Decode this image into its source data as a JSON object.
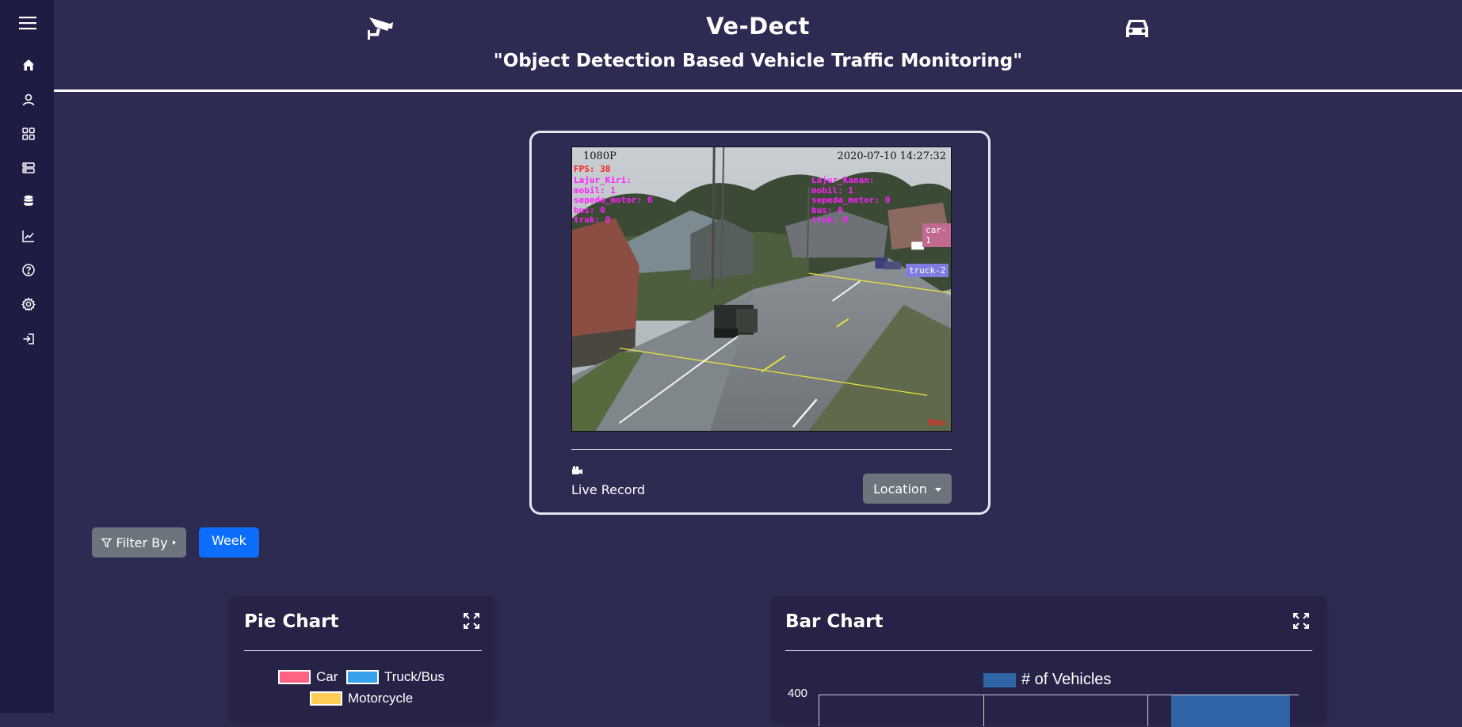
{
  "sidebar": {
    "menu_icon": "hamburger-icon",
    "items": [
      {
        "icon": "home-icon"
      },
      {
        "icon": "user-icon"
      },
      {
        "icon": "grid-icon"
      },
      {
        "icon": "server-icon"
      },
      {
        "icon": "database-icon"
      },
      {
        "icon": "chart-line-icon"
      },
      {
        "icon": "help-icon"
      },
      {
        "icon": "settings-icon"
      },
      {
        "icon": "logout-icon"
      }
    ]
  },
  "header": {
    "title": "Ve-Dect",
    "subtitle": "\"Object Detection Based Vehicle Traffic Monitoring\"",
    "left_icon": "cctv-camera-icon",
    "right_icon": "car-icon"
  },
  "video": {
    "resolution": "1080P",
    "datetime": "2020-07-10  14:27:32",
    "fps": "FPS: 38",
    "left_lane": [
      "Lajur_Kiri:",
      "mobil: 1",
      "sepeda_motor: 0",
      "bus: 0",
      "truk: 0"
    ],
    "right_lane": [
      "Lajur_Kanan:",
      "mobil: 1",
      "sepeda_motor: 0",
      "bus: 0",
      "truk: 0"
    ],
    "tag_car": "car-1",
    "tag_truck": "truck-2",
    "rec": "Rec",
    "record_label": "Live Record",
    "location_button": "Location"
  },
  "filters": {
    "filter_by": "Filter By",
    "period": "Week"
  },
  "pie_panel": {
    "title": "Pie Chart",
    "legend": [
      "Car",
      "Truck/Bus",
      "Motorcycle"
    ]
  },
  "bar_panel": {
    "title": "Bar Chart",
    "legend": "# of Vehicles",
    "y_top_tick": "400"
  },
  "colors": {
    "sidebar": "#1f1c44",
    "background": "#2e2b52",
    "car": "#ff6384",
    "truck_bus": "#36a2eb",
    "motorcycle": "#ffcd56",
    "bar": "#2f65a6",
    "primary_button": "#0d6efd",
    "secondary_button": "#6c757d"
  }
}
